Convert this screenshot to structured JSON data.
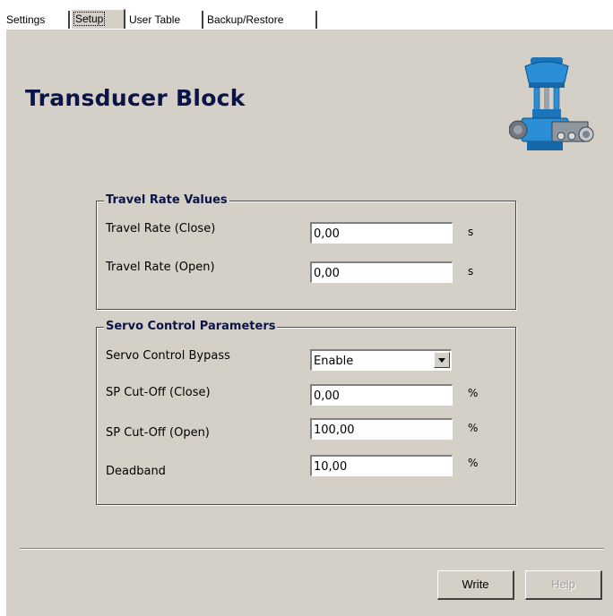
{
  "tabs": [
    {
      "label": "Settings"
    },
    {
      "label": "Setup"
    },
    {
      "label": "User Table"
    },
    {
      "label": "Backup/Restore"
    }
  ],
  "page_title": "Transducer Block",
  "travel_rate": {
    "legend": "Travel Rate Values",
    "close_label": "Travel Rate (Close)",
    "close_value": "0,00",
    "close_unit": "s",
    "open_label": "Travel Rate (Open)",
    "open_value": "0,00",
    "open_unit": "s"
  },
  "servo": {
    "legend": "Servo Control Parameters",
    "bypass_label": "Servo Control Bypass",
    "bypass_value": "Enable",
    "cutoff_close_label": "SP Cut-Off (Close)",
    "cutoff_close_value": "0,00",
    "cutoff_close_unit": "%",
    "cutoff_open_label": "SP Cut-Off (Open)",
    "cutoff_open_value": "100,00",
    "cutoff_open_unit": "%",
    "deadband_label": "Deadband",
    "deadband_value": "10,00",
    "deadband_unit": "%"
  },
  "buttons": {
    "write": "Write",
    "help": "Help"
  }
}
